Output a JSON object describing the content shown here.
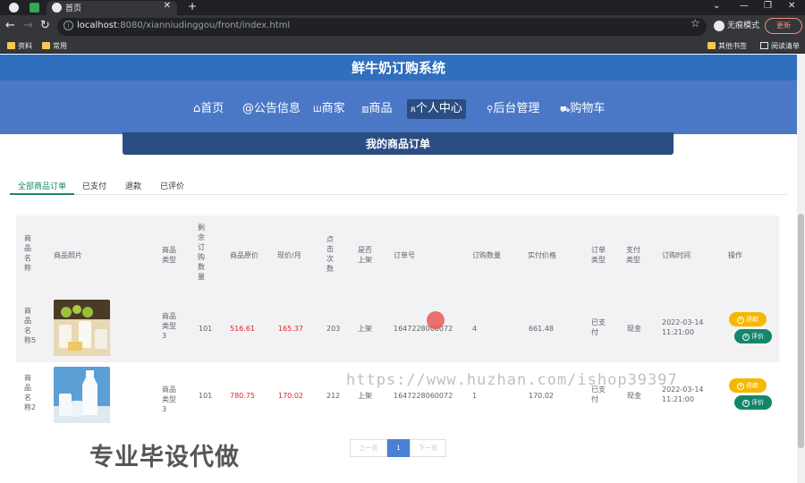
{
  "browser": {
    "tab_title": "首页",
    "url_host": "localhost",
    "url_rest": ":8080/xianniudinggou/front/index.html",
    "incognito_label": "无痕模式",
    "update_label": "更新",
    "bookmarks": [
      "资料",
      "常用"
    ],
    "bookmarks_right": [
      "其他书签",
      "阅读清单"
    ]
  },
  "site": {
    "title": "鲜牛奶订购系统",
    "nav": [
      {
        "icon": "home-icon",
        "label": "首页"
      },
      {
        "icon": "announcement-icon",
        "label": "公告信息"
      },
      {
        "icon": "merchant-icon",
        "label": "商家"
      },
      {
        "icon": "goods-icon",
        "label": "商品"
      },
      {
        "icon": "user-icon",
        "label": "个人中心"
      },
      {
        "icon": "admin-icon",
        "label": "后台管理"
      },
      {
        "icon": "cart-icon",
        "label": "购物车"
      }
    ],
    "nav_glyphs": [
      "⌂",
      "@",
      "Ш",
      "▥",
      "ጸ",
      "🔗",
      "🛒"
    ]
  },
  "orders": {
    "section_title": "我的商品订单",
    "tabs": [
      "全部商品订单",
      "已支付",
      "退款",
      "已评价"
    ],
    "columns": [
      "商品名称",
      "商品照片",
      "商品类型",
      "剩余订购数量",
      "商品原价",
      "现价/月",
      "点击次数",
      "是否上架",
      "订单号",
      "订购数量",
      "实付价格",
      "订单类型",
      "支付类型",
      "订购时间",
      "操作"
    ],
    "rows": [
      {
        "name": "商品名称5",
        "type": "商品类型3",
        "remaining": "101",
        "original_price": "516.61",
        "price_month": "165.37",
        "clicks": "203",
        "on_shelf": "上架",
        "order_no": "1647228060072",
        "quantity": "4",
        "paid": "661.48",
        "order_type": "已支付",
        "pay_type": "现金",
        "time": "2022-03-14 11:21:00",
        "btn_refund": "退款",
        "btn_review": "评价"
      },
      {
        "name": "商品名称2",
        "type": "商品类型3",
        "remaining": "101",
        "original_price": "780.75",
        "price_month": "170.02",
        "clicks": "212",
        "on_shelf": "上架",
        "order_no": "1647228060072",
        "quantity": "1",
        "paid": "170.02",
        "order_type": "已支付",
        "pay_type": "现金",
        "time": "2022-03-14 11:21:00",
        "btn_refund": "退款",
        "btn_review": "评价"
      }
    ]
  },
  "pagination": {
    "prev": "上一页",
    "current": "1",
    "next": "下一页"
  },
  "overlay": {
    "watermark": "https://www.huzhan.com/ishop39397",
    "promo": "专业毕设代做"
  },
  "colors": {
    "header": "#2f6fbe",
    "nav": "#4b78c6",
    "active": "#2a4d82",
    "accent_green": "#13866b",
    "accent_yellow": "#f5b800",
    "price_red": "#e0242a"
  }
}
